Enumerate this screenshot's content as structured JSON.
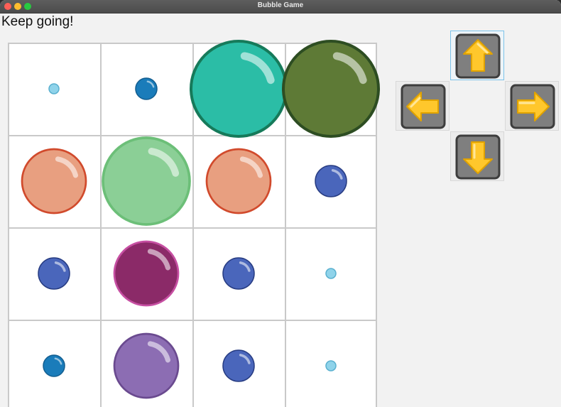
{
  "window": {
    "title": "Bubble Game"
  },
  "status": {
    "text": "Keep going!"
  },
  "controls": {
    "up": {
      "label": "up",
      "icon": "arrow-up-icon"
    },
    "left": {
      "label": "left",
      "icon": "arrow-left-icon"
    },
    "right": {
      "label": "right",
      "icon": "arrow-right-icon"
    },
    "down": {
      "label": "down",
      "icon": "arrow-down-icon"
    },
    "focused": "up",
    "arrow_color": "#ffc72c",
    "button_color": "#7f7f7f"
  },
  "grid": {
    "rows": 4,
    "cols": 4,
    "cells": [
      [
        {
          "color": "#8fd3ea",
          "border": "#5ab0cf",
          "size": "tiny"
        },
        {
          "color": "#1a7cba",
          "border": "#125d8f",
          "size": "small"
        },
        {
          "color": "#2bbda6",
          "border": "#167a5a",
          "size": "huge"
        },
        {
          "color": "#5e7a36",
          "border": "#2d4d22",
          "size": "huge"
        }
      ],
      [
        {
          "color": "#e89f80",
          "border": "#d14a2c",
          "size": "large"
        },
        {
          "color": "#8bcf96",
          "border": "#6cbf78",
          "size": "xlarge"
        },
        {
          "color": "#e89f80",
          "border": "#d14a2c",
          "size": "large"
        },
        {
          "color": "#4a66bb",
          "border": "#273c82",
          "size": "medium"
        }
      ],
      [
        {
          "color": "#4a66bb",
          "border": "#273c82",
          "size": "medium"
        },
        {
          "color": "#8b2a68",
          "border": "#c64fa2",
          "size": "large"
        },
        {
          "color": "#4a66bb",
          "border": "#273c82",
          "size": "medium"
        },
        {
          "color": "#8fd3ea",
          "border": "#5ab0cf",
          "size": "tiny"
        }
      ],
      [
        {
          "color": "#1a7cba",
          "border": "#125d8f",
          "size": "small"
        },
        {
          "color": "#8c6db3",
          "border": "#6a4a8f",
          "size": "large"
        },
        {
          "color": "#4a66bb",
          "border": "#273c82",
          "size": "medium"
        },
        {
          "color": "#8fd3ea",
          "border": "#5ab0cf",
          "size": "tiny"
        }
      ]
    ]
  }
}
